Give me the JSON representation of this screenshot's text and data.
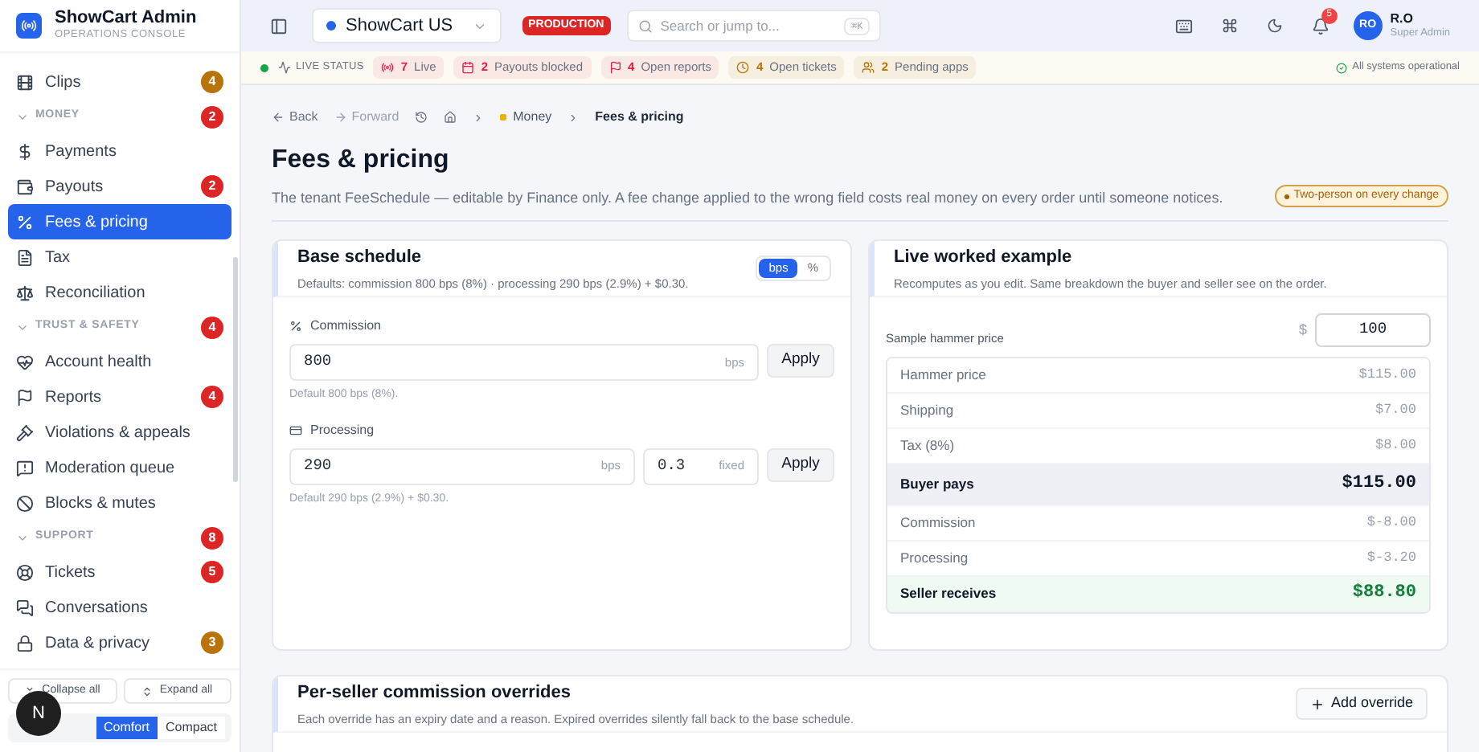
{
  "brand": {
    "title": "ShowCart Admin",
    "subtitle": "OPERATIONS CONSOLE"
  },
  "sidebar": {
    "items": [
      {
        "kind": "item",
        "label": "Clips",
        "badge": "4",
        "color": "#b8730b",
        "selected": false
      },
      {
        "kind": "section",
        "label": "MONEY",
        "badge": "2",
        "color": "#dc2626",
        "expanded": true
      },
      {
        "kind": "item",
        "label": "Payments",
        "selected": false
      },
      {
        "kind": "item",
        "label": "Payouts",
        "badge": "2",
        "color": "#dc2626",
        "selected": false
      },
      {
        "kind": "item",
        "label": "Fees & pricing",
        "selected": true
      },
      {
        "kind": "item",
        "label": "Tax",
        "selected": false
      },
      {
        "kind": "item",
        "label": "Reconciliation",
        "selected": false
      },
      {
        "kind": "section",
        "label": "TRUST & SAFETY",
        "badge": "4",
        "color": "#dc2626",
        "expanded": true
      },
      {
        "kind": "item",
        "label": "Account health",
        "selected": false
      },
      {
        "kind": "item",
        "label": "Reports",
        "badge": "4",
        "color": "#dc2626",
        "selected": false
      },
      {
        "kind": "item",
        "label": "Violations & appeals",
        "selected": false
      },
      {
        "kind": "item",
        "label": "Moderation queue",
        "selected": false
      },
      {
        "kind": "item",
        "label": "Blocks & mutes",
        "selected": false
      },
      {
        "kind": "section",
        "label": "SUPPORT",
        "badge": "8",
        "color": "#dc2626",
        "expanded": true
      },
      {
        "kind": "item",
        "label": "Tickets",
        "badge": "5",
        "color": "#dc2626",
        "selected": false
      },
      {
        "kind": "item",
        "label": "Conversations",
        "selected": false
      },
      {
        "kind": "item",
        "label": "Data & privacy",
        "badge": "3",
        "color": "#b8730b",
        "selected": false
      }
    ],
    "collapse_all": "Collapse all",
    "expand_all": "Expand all",
    "density": [
      {
        "label": "Comfort",
        "selected": true
      },
      {
        "label": "Compact",
        "selected": false
      }
    ]
  },
  "dev_badge": "N",
  "topbar": {
    "tenant": "ShowCart US",
    "environment": "PRODUCTION",
    "search": {
      "placeholder": "Search or jump to...",
      "shortcut": "⌘K"
    },
    "notifications": "5",
    "user": {
      "initials": "RO",
      "name": "R.O",
      "role": "Super Admin"
    }
  },
  "status_strip": {
    "label": "LIVE STATUS",
    "chips": [
      {
        "count": "7",
        "label": "Live",
        "color": "#e11d48"
      },
      {
        "count": "2",
        "label": "Payouts blocked",
        "color": "#e11d48"
      },
      {
        "count": "4",
        "label": "Open reports",
        "color": "#e11d48"
      },
      {
        "count": "4",
        "label": "Open tickets",
        "color": "#b8730b"
      },
      {
        "count": "2",
        "label": "Pending apps",
        "color": "#b8730b"
      }
    ],
    "health": "All systems operational"
  },
  "breadcrumb": {
    "back": "Back",
    "forward": "Forward",
    "forward_disabled": true,
    "section": "Money",
    "current": "Fees & pricing"
  },
  "page": {
    "title": "Fees & pricing",
    "description": "The tenant FeeSchedule — editable by Finance only. A fee change applied to the wrong field costs real money on every order until someone notices.",
    "badge": "Two-person on every change"
  },
  "base_schedule": {
    "title": "Base schedule",
    "subtitle": "Defaults: commission 800 bps (8%) · processing 290 bps (2.9%) + $0.30.",
    "units": [
      {
        "label": "bps",
        "selected": true
      },
      {
        "label": "%",
        "selected": false
      }
    ],
    "commission": {
      "label": "Commission",
      "value": "800",
      "unit": "bps",
      "apply": "Apply",
      "hint": "Default 800 bps (8%)."
    },
    "processing": {
      "label": "Processing",
      "value": "290",
      "unit": "bps",
      "fixed_value": "0.3",
      "fixed_unit": "fixed",
      "apply": "Apply",
      "hint": "Default 290 bps (2.9%) + $0.30."
    }
  },
  "live_example": {
    "title": "Live worked example",
    "subtitle": "Recomputes as you edit. Same breakdown the buyer and seller see on the order.",
    "price_label": "Sample hammer price",
    "currency": "$",
    "price": "100",
    "rows": [
      {
        "kind": "line",
        "label": "Hammer price",
        "amount": "$115.00"
      },
      {
        "kind": "line",
        "label": "Shipping",
        "amount": "$7.00"
      },
      {
        "kind": "line",
        "label": "Tax (8%)",
        "amount": "$8.00"
      },
      {
        "kind": "total",
        "label": "Buyer pays",
        "amount": "$115.00"
      },
      {
        "kind": "line",
        "label": "Commission",
        "amount": "$-8.00"
      },
      {
        "kind": "line",
        "label": "Processing",
        "amount": "$-3.20"
      },
      {
        "kind": "net",
        "label": "Seller receives",
        "amount": "$88.80"
      }
    ]
  },
  "overrides": {
    "title": "Per-seller commission overrides",
    "subtitle": "Each override has an expiry date and a reason. Expired overrides silently fall back to the base schedule.",
    "add": "Add override"
  }
}
